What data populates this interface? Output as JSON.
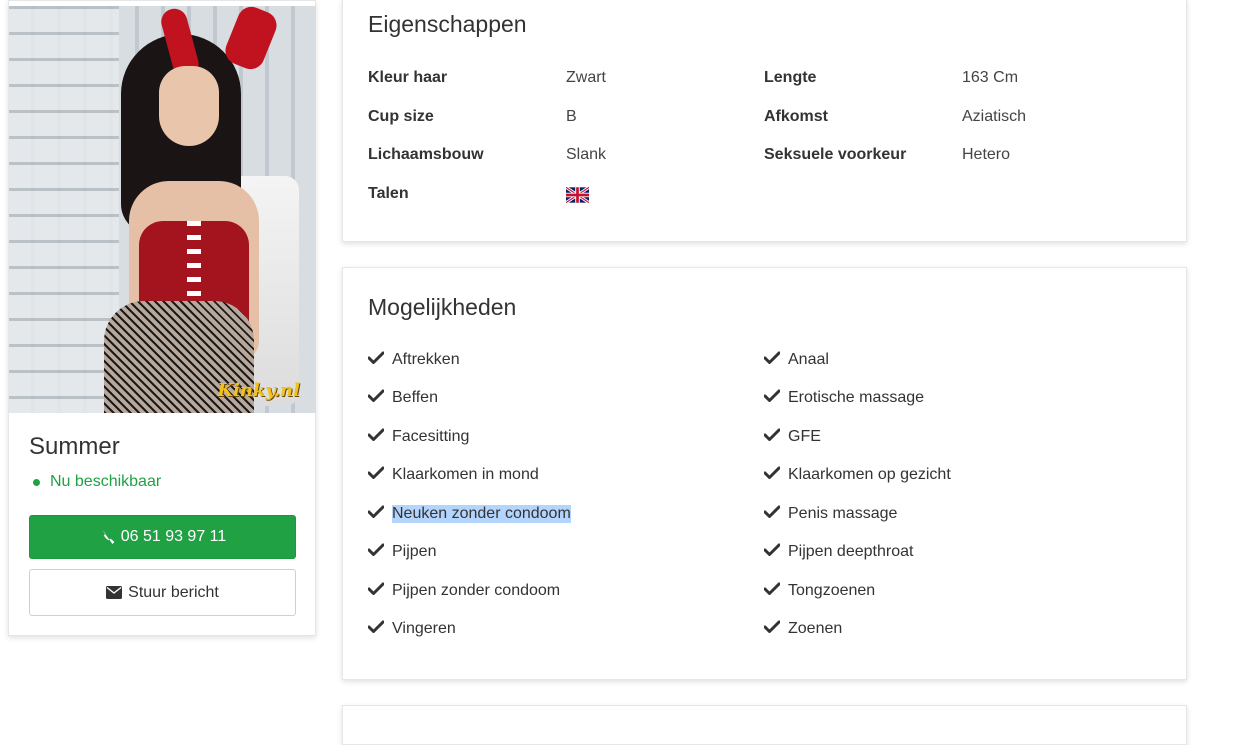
{
  "profile": {
    "name": "Summer",
    "status": "Nu beschikbaar",
    "watermark": "Kinky.nl",
    "phone_label": "06 51 93 97 11",
    "message_label": "Stuur bericht",
    "status_color": "#1fa144"
  },
  "properties": {
    "title": "Eigenschappen",
    "rows": [
      {
        "label1": "Kleur haar",
        "value1": "Zwart",
        "label2": "Lengte",
        "value2": "163 Cm"
      },
      {
        "label1": "Cup size",
        "value1": "B",
        "label2": "Afkomst",
        "value2": "Aziatisch"
      },
      {
        "label1": "Lichaamsbouw",
        "value1": "Slank",
        "label2": "Seksuele voorkeur",
        "value2": "Hetero"
      },
      {
        "label1": "Talen",
        "value1_icon": "uk-flag-icon"
      }
    ]
  },
  "options": {
    "title": "Mogelijkheden",
    "left": [
      "Aftrekken",
      "Beffen",
      "Facesitting",
      "Klaarkomen in mond",
      "Neuken zonder condoom",
      "Pijpen",
      "Pijpen zonder condoom",
      "Vingeren"
    ],
    "right": [
      "Anaal",
      "Erotische massage",
      "GFE",
      "Klaarkomen op gezicht",
      "Penis massage",
      "Pijpen deepthroat",
      "Tongzoenen",
      "Zoenen"
    ],
    "highlighted": "Neuken zonder condoom",
    "icon": "check-icon"
  }
}
